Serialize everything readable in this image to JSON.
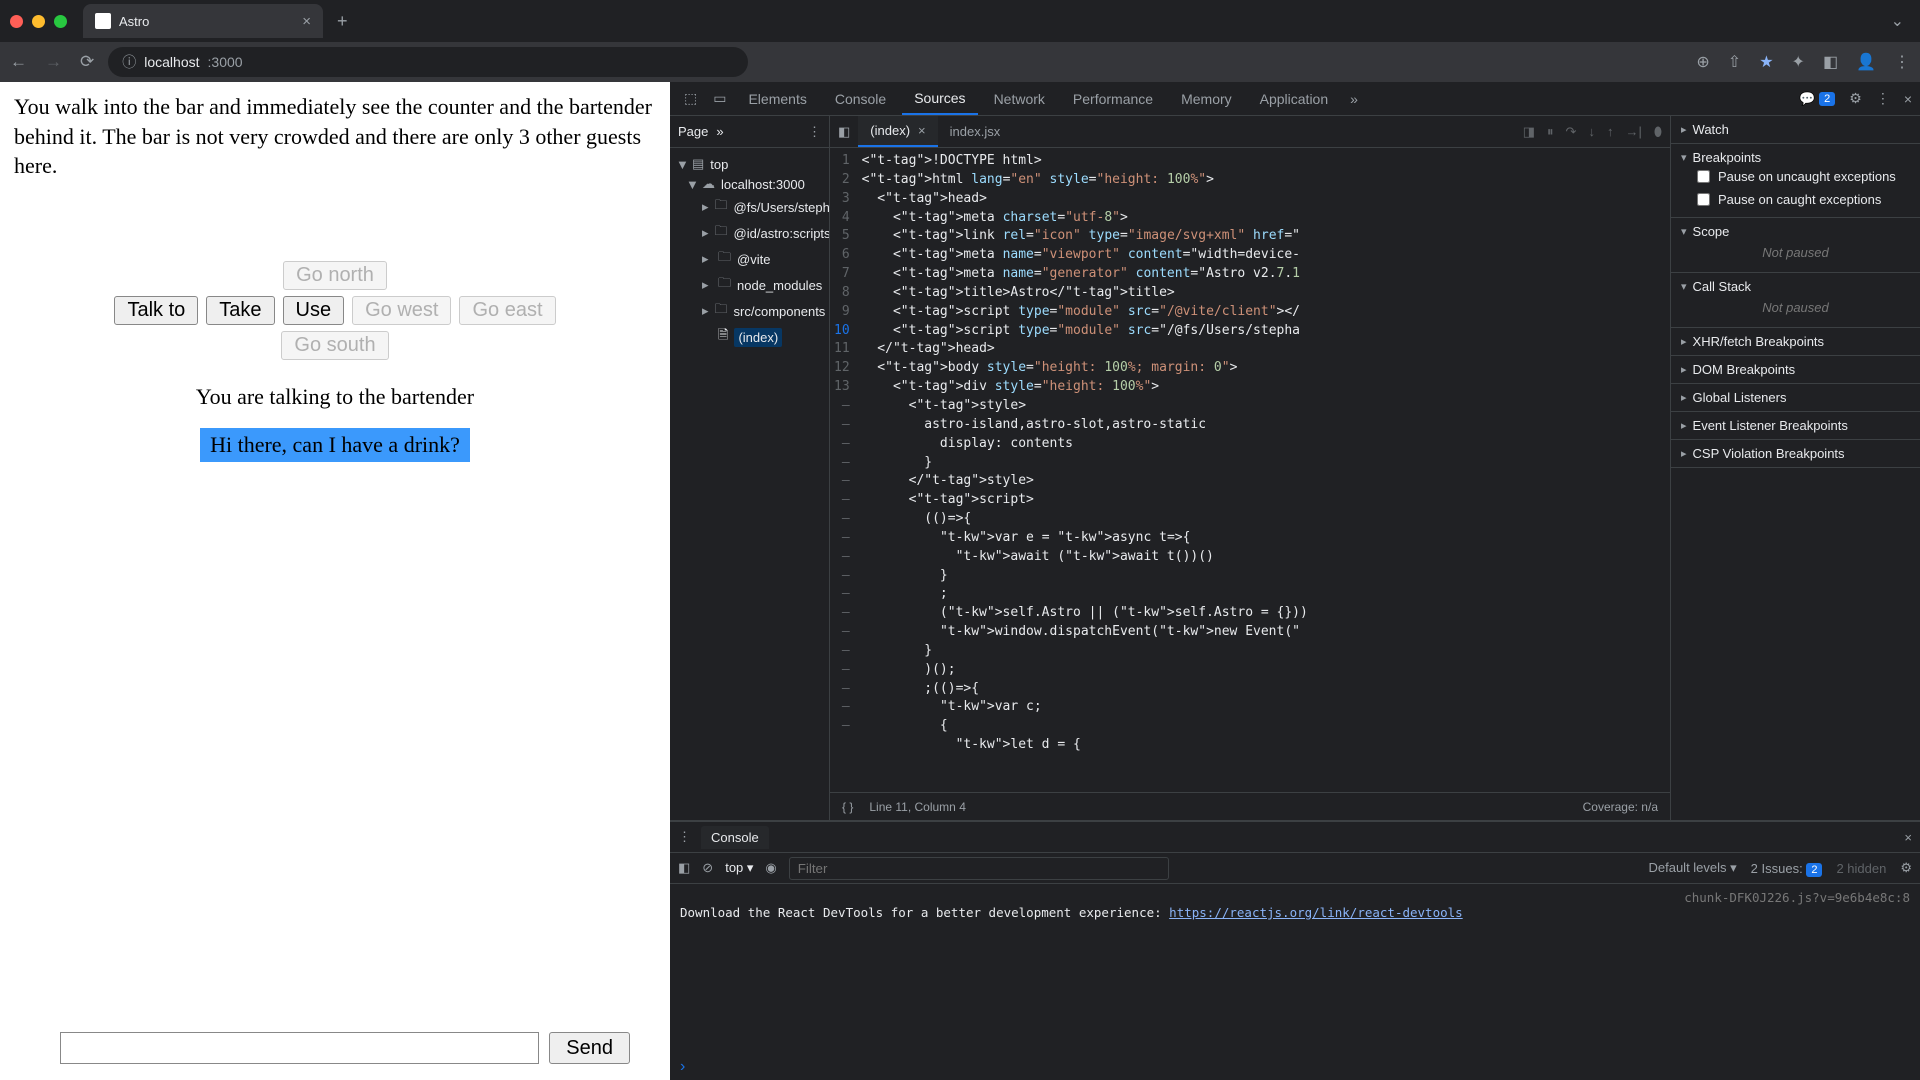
{
  "browser": {
    "tab_title": "Astro",
    "url_host": "localhost",
    "url_port": ":3000"
  },
  "page": {
    "story": "You walk into the bar and immediately see the counter and the bartender behind it. The bar is not very crowded and there are only 3 other guests here.",
    "actions": {
      "talk": "Talk to",
      "take": "Take",
      "use": "Use"
    },
    "dirs": {
      "north": "Go north",
      "south": "Go south",
      "east": "Go east",
      "west": "Go west"
    },
    "status": "You are talking to the bartender",
    "dialog": "Hi there, can I have a drink?",
    "send": "Send"
  },
  "devtools": {
    "tabs": {
      "elements": "Elements",
      "console": "Console",
      "sources": "Sources",
      "network": "Network",
      "performance": "Performance",
      "memory": "Memory",
      "application": "Application"
    },
    "issues_count": "2",
    "navigator": {
      "page_tab": "Page",
      "top": "top",
      "host": "localhost:3000",
      "folders": [
        "@fs/Users/stepha",
        "@id/astro:scripts",
        "@vite",
        "node_modules",
        "src/components"
      ],
      "file": "(index)"
    },
    "editor": {
      "tabs": {
        "index": "(index)",
        "indexjsx": "index.jsx"
      },
      "gutter_nums": [
        "1",
        "2",
        "3",
        "4",
        "5",
        "6",
        "7",
        "8",
        "9",
        "10",
        "11",
        "12",
        "13"
      ],
      "gutter_dashes_count": 18,
      "status_left": "Line 11, Column 4",
      "status_right": "Coverage: n/a",
      "code_lines": [
        "<!DOCTYPE html>",
        "<html lang=\"en\" style=\"height: 100%\">",
        "  <head>",
        "    <meta charset=\"utf-8\">",
        "    <link rel=\"icon\" type=\"image/svg+xml\" href=\"",
        "    <meta name=\"viewport\" content=\"width=device-",
        "    <meta name=\"generator\" content=\"Astro v2.7.1",
        "    <title>Astro</title>",
        "    <script type=\"module\" src=\"/@vite/client\"></",
        "    <script type=\"module\" src=\"/@fs/Users/stepha",
        "  </head>",
        "  <body style=\"height: 100%; margin: 0\">",
        "    <div style=\"height: 100%\">",
        "      <style>",
        "        astro-island,astro-slot,astro-static",
        "          display: contents",
        "        }",
        "      </style>",
        "      <script>",
        "        (()=>{",
        "          var e = async t=>{",
        "            await (await t())()",
        "          }",
        "          ;",
        "          (self.Astro || (self.Astro = {}))",
        "          window.dispatchEvent(new Event(\"",
        "        }",
        "        )();",
        "        ;(()=>{",
        "          var c;",
        "          {",
        "            let d = {"
      ]
    },
    "sidebar": {
      "watch": "Watch",
      "breakpoints": "Breakpoints",
      "pause_uncaught": "Pause on uncaught exceptions",
      "pause_caught": "Pause on caught exceptions",
      "scope": "Scope",
      "not_paused": "Not paused",
      "callstack": "Call Stack",
      "xhr": "XHR/fetch Breakpoints",
      "dom": "DOM Breakpoints",
      "global": "Global Listeners",
      "event": "Event Listener Breakpoints",
      "csp": "CSP Violation Breakpoints"
    },
    "console": {
      "tab": "Console",
      "context": "top",
      "filter_placeholder": "Filter",
      "levels": "Default levels",
      "issues_label": "2 Issues:",
      "issues_badge": "2",
      "hidden": "2 hidden",
      "src": "chunk-DFK0J226.js?v=9e6b4e8c:8",
      "msg": "Download the React DevTools for a better development experience: ",
      "link": "https://reactjs.org/link/react-devtools"
    }
  }
}
